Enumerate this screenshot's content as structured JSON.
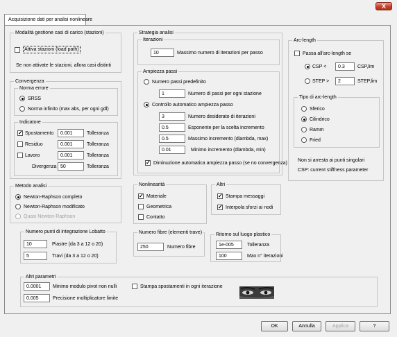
{
  "window": {
    "close_label": "X"
  },
  "tab": {
    "label": "Acquisizione dati per analisi nonlineare"
  },
  "load_cases": {
    "legend": "Modalità gestione casi di carico (stazioni)",
    "checkbox_label": "Attiva stazioni (load path)",
    "note": "Se non attivate le stazioni, allora casi distinti"
  },
  "convergence": {
    "legend": "Convergenza",
    "norm_legend": "Norma errore",
    "norm_srss": "SRSS",
    "norm_infinity": "Norma infinito (max abs, per ogni gdl)",
    "indicator_legend": "Indicatore",
    "rows": [
      {
        "label": "Spostamento",
        "value": "0.001",
        "unit": "Tolleranza",
        "checked": true
      },
      {
        "label": "Residuo",
        "value": "0.001",
        "unit": "Tolleranza",
        "checked": false
      },
      {
        "label": "Lavoro",
        "value": "0.001",
        "unit": "Tolleranza",
        "checked": false
      }
    ],
    "divergence_label": "Divergenza",
    "divergence_value": "50",
    "divergence_unit": "Tolleranza"
  },
  "analysis_method": {
    "legend": "Metodo analisi",
    "options": [
      "Newton-Raphson completo",
      "Newton-Raphson modificato",
      "Quasi Newton-Raphson"
    ]
  },
  "strategy": {
    "legend": "Strategia analisi",
    "iterations_legend": "Iterazioni",
    "max_iter_value": "10",
    "max_iter_label": "Massimo numero di iterazioni per passo",
    "step_legend": "Ampiezza passi",
    "predefined_label": "Numero passi predefinito",
    "steps_value": "1",
    "steps_label": "Numero di passi per ogni stazione",
    "auto_label": "Controllo automatico ampiezza passo",
    "desired_iter_value": "3",
    "desired_iter_label": "Numero desiderato di iterazioni",
    "exponent_value": "0.5",
    "exponent_label": "Esponente per la scelta incremento",
    "max_inc_value": "0.5",
    "max_inc_label": "Massimo incremento (dlambda, max)",
    "min_inc_value": "0.01",
    "min_inc_label": "Minimo incremento (dlambda, min)",
    "auto_decrease_label": "Diminuzione automatica ampiezza passo (se no convergenza)"
  },
  "arc_length": {
    "legend": "Arc-length",
    "switch_label": "Passa all'arc-length se",
    "csp_label": "CSP <",
    "csp_value": "0.3",
    "csp_unit": "CSP,lim",
    "step_label": "STEP >",
    "step_value": "2",
    "step_unit": "STEP,lim",
    "type_legend": "Tipo di arc-length",
    "types": [
      "Sferico",
      "Cilindrico",
      "Ramm",
      "Fried"
    ],
    "note1": "Non si arresta ai punti singolari",
    "note2": "CSP: current stiffness parameter"
  },
  "nonlinearity": {
    "legend": "Nonlinearità",
    "items": [
      {
        "label": "Materiale",
        "checked": true
      },
      {
        "label": "Geometrica",
        "checked": false
      },
      {
        "label": "Contatto",
        "checked": false
      }
    ]
  },
  "other": {
    "legend": "Altri",
    "items": [
      {
        "label": "Stampa messaggi",
        "checked": true
      },
      {
        "label": "Interpola sforzi ai nodi",
        "checked": true
      }
    ]
  },
  "lobatto": {
    "legend": "Numero punti di integrazione Lobatto",
    "plates_value": "10",
    "plates_label": "Piastre (da 3 a 12 o 20)",
    "beams_value": "5",
    "beams_label": "Travi (da 3 a 12 o 20)"
  },
  "fibers": {
    "legend": "Numero fibre (elementi trave)",
    "value": "250",
    "label": "Numero fibre"
  },
  "plastic_return": {
    "legend": "Ritorno sul luogo plastico",
    "tol_value": "1e-005",
    "tol_label": "Tolleranza",
    "max_value": "100",
    "max_label": "Max n° iterazioni"
  },
  "other_params": {
    "legend": "Altri parametri",
    "pivot_value": "0.0001",
    "pivot_label": "Minimo modulo pivot non nulli",
    "precision_value": "0.005",
    "precision_label": "Precisione moltiplicatore limite",
    "print_label": "Stampa spostamenti in ogni iterazione"
  },
  "buttons": {
    "ok": "OK",
    "cancel": "Annulla",
    "apply": "Applica",
    "help": "?"
  }
}
